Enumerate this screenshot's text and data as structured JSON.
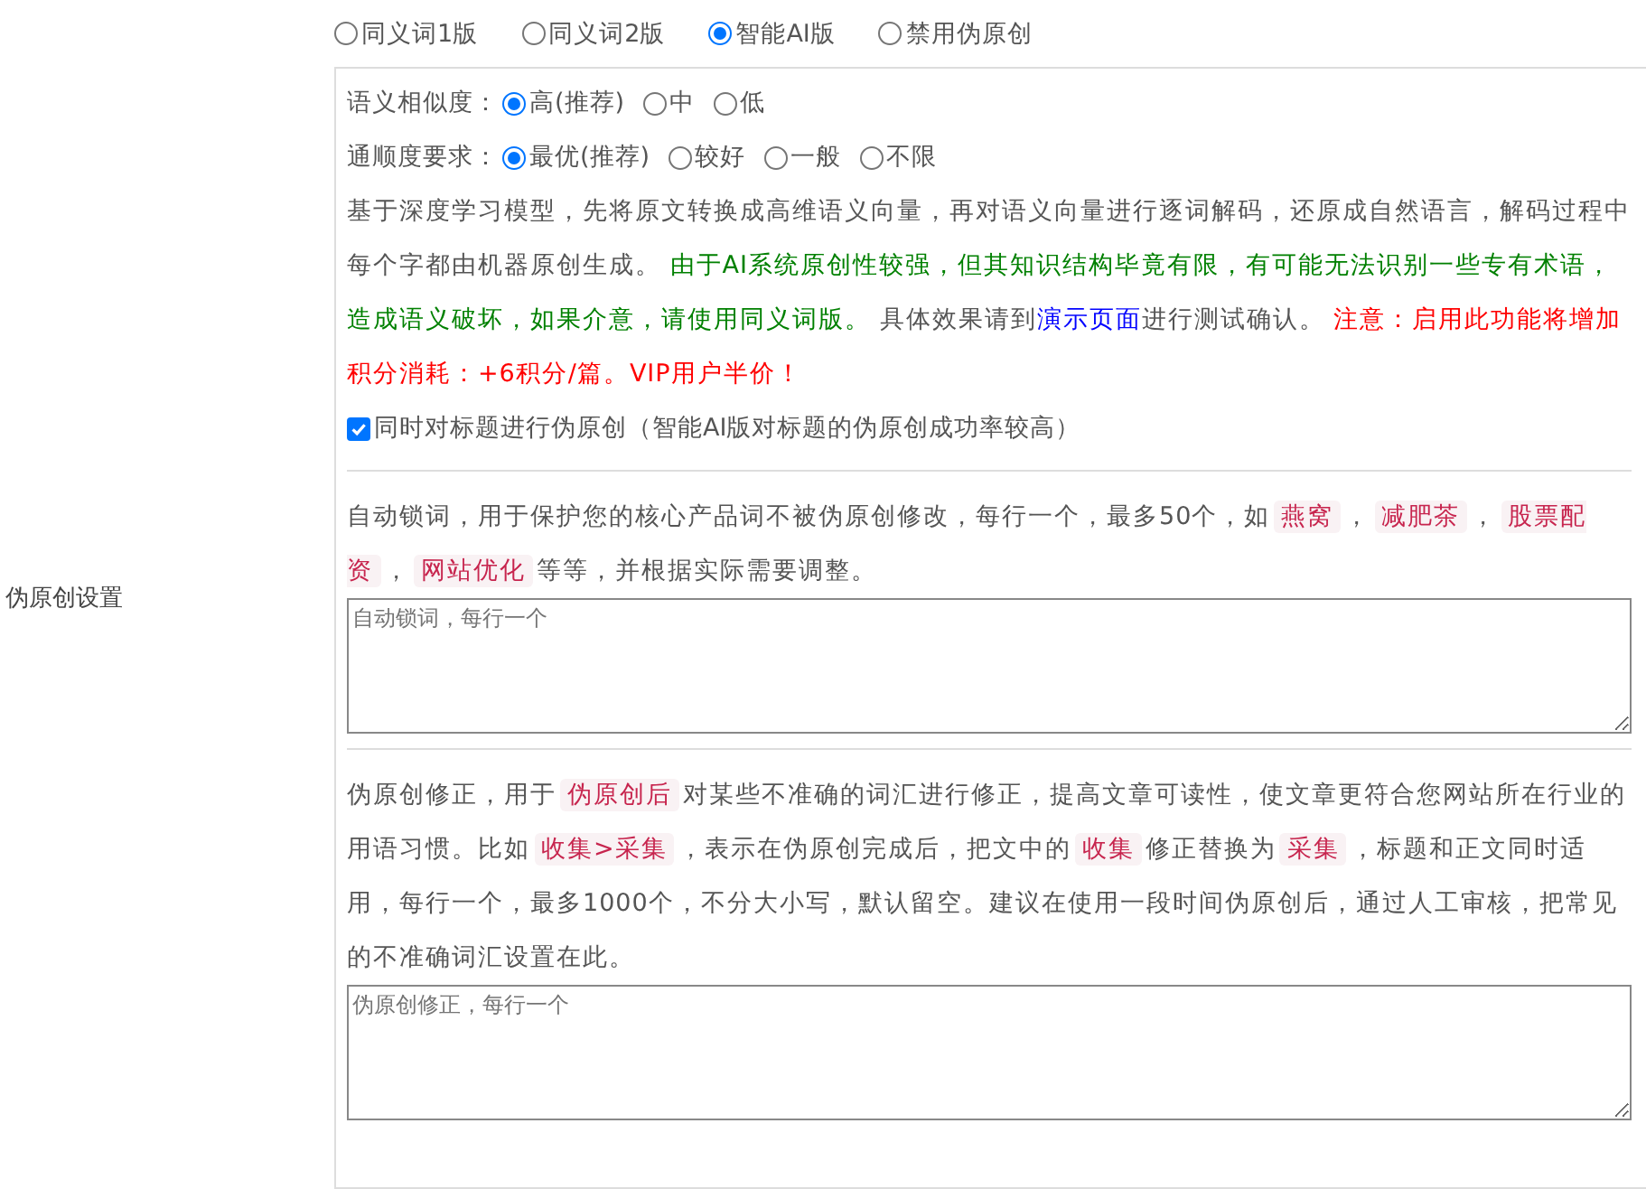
{
  "mode_options": [
    {
      "label": "同义词1版",
      "selected": false
    },
    {
      "label": "同义词2版",
      "selected": false
    },
    {
      "label": "智能AI版",
      "selected": true
    },
    {
      "label": "禁用伪原创",
      "selected": false
    }
  ],
  "similarity": {
    "label": "语义相似度：",
    "options": [
      {
        "label": "高(推荐)",
        "selected": true
      },
      {
        "label": "中",
        "selected": false
      },
      {
        "label": "低",
        "selected": false
      }
    ]
  },
  "fluency": {
    "label": "通顺度要求：",
    "options": [
      {
        "label": "最优(推荐)",
        "selected": true
      },
      {
        "label": "较好",
        "selected": false
      },
      {
        "label": "一般",
        "selected": false
      },
      {
        "label": "不限",
        "selected": false
      }
    ]
  },
  "description": [
    {
      "kind": "plain",
      "text": "基于深度学习模型，先将原文转换成高维语义向量，再对语义向量进行逐词解码，还原成自然语言，解码过程中每个字都由机器原创生成。 "
    },
    {
      "kind": "green",
      "text": "由于AI系统原创性较强，但其知识结构毕竟有限，有可能无法识别一些专有术语，造成语义破坏，如果介意，请使用同义词版。"
    },
    {
      "kind": "plain",
      "text": " 具体效果请到"
    },
    {
      "kind": "link",
      "text": "演示页面"
    },
    {
      "kind": "plain",
      "text": "进行测试确认。 "
    },
    {
      "kind": "red",
      "text": "注意：启用此功能将增加积分消耗：+6积分/篇。VIP用户半价！"
    }
  ],
  "title_checkbox": {
    "label": "同时对标题进行伪原创（智能AI版对标题的伪原创成功率较高）",
    "checked": true
  },
  "side_label": "伪原创设置",
  "lock_words": {
    "paragraph": [
      {
        "kind": "plain",
        "text": "自动锁词，用于保护您的核心产品词不被伪原创修改，每行一个，最多50个，如"
      },
      {
        "kind": "tag",
        "text": "燕窝"
      },
      {
        "kind": "plain",
        "text": "，"
      },
      {
        "kind": "tag",
        "text": "减肥茶"
      },
      {
        "kind": "plain",
        "text": "，"
      },
      {
        "kind": "tag",
        "text": "股票配资"
      },
      {
        "kind": "plain",
        "text": "，"
      },
      {
        "kind": "tag",
        "text": "网站优化"
      },
      {
        "kind": "plain",
        "text": "等等，并根据实际需要调整。"
      }
    ],
    "placeholder": "自动锁词，每行一个"
  },
  "correction": {
    "paragraph": [
      {
        "kind": "plain",
        "text": "伪原创修正，用于"
      },
      {
        "kind": "tag",
        "text": "伪原创后"
      },
      {
        "kind": "plain",
        "text": "对某些不准确的词汇进行修正，提高文章可读性，使文章更符合您网站所在行业的用语习惯。比如"
      },
      {
        "kind": "tag",
        "text": "收集>采集"
      },
      {
        "kind": "plain",
        "text": "，表示在伪原创完成后，把文中的"
      },
      {
        "kind": "tag",
        "text": "收集"
      },
      {
        "kind": "plain",
        "text": "修正替换为"
      },
      {
        "kind": "tag",
        "text": "采集"
      },
      {
        "kind": "plain",
        "text": "，标题和正文同时适用，每行一个，最多1000个，不分大小写，默认留空。建议在使用一段时间伪原创后，通过人工审核，把常见的不准确词汇设置在此。"
      }
    ],
    "placeholder": "伪原创修正，每行一个"
  }
}
